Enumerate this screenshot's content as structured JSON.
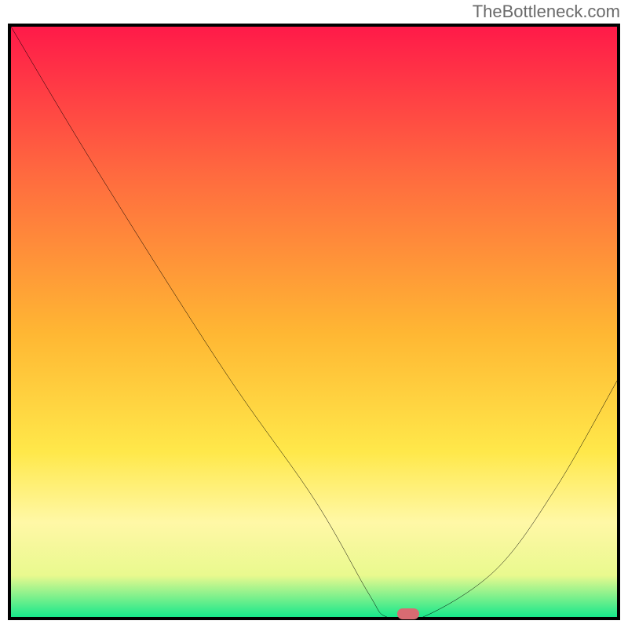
{
  "watermark": "TheBottleneck.com",
  "chart_data": {
    "type": "line",
    "title": "",
    "xlabel": "",
    "ylabel": "",
    "xlim": [
      0,
      100
    ],
    "ylim": [
      0,
      100
    ],
    "series": [
      {
        "name": "bottleneck-curve",
        "x": [
          0,
          14,
          35,
          50,
          59,
          62,
          68,
          80,
          90,
          100
        ],
        "y": [
          100,
          76,
          42,
          20,
          4,
          0,
          0,
          8,
          22,
          40
        ]
      }
    ],
    "marker": {
      "x": 65.5,
      "y": 0.5,
      "color": "#d86b72"
    },
    "gradient_stops": [
      {
        "offset": 0.0,
        "color": "#ff1a49"
      },
      {
        "offset": 0.25,
        "color": "#ff6a3f"
      },
      {
        "offset": 0.52,
        "color": "#ffb733"
      },
      {
        "offset": 0.72,
        "color": "#ffe84a"
      },
      {
        "offset": 0.84,
        "color": "#fff8a6"
      },
      {
        "offset": 0.93,
        "color": "#e9f98e"
      },
      {
        "offset": 1.0,
        "color": "#17e88b"
      }
    ]
  }
}
